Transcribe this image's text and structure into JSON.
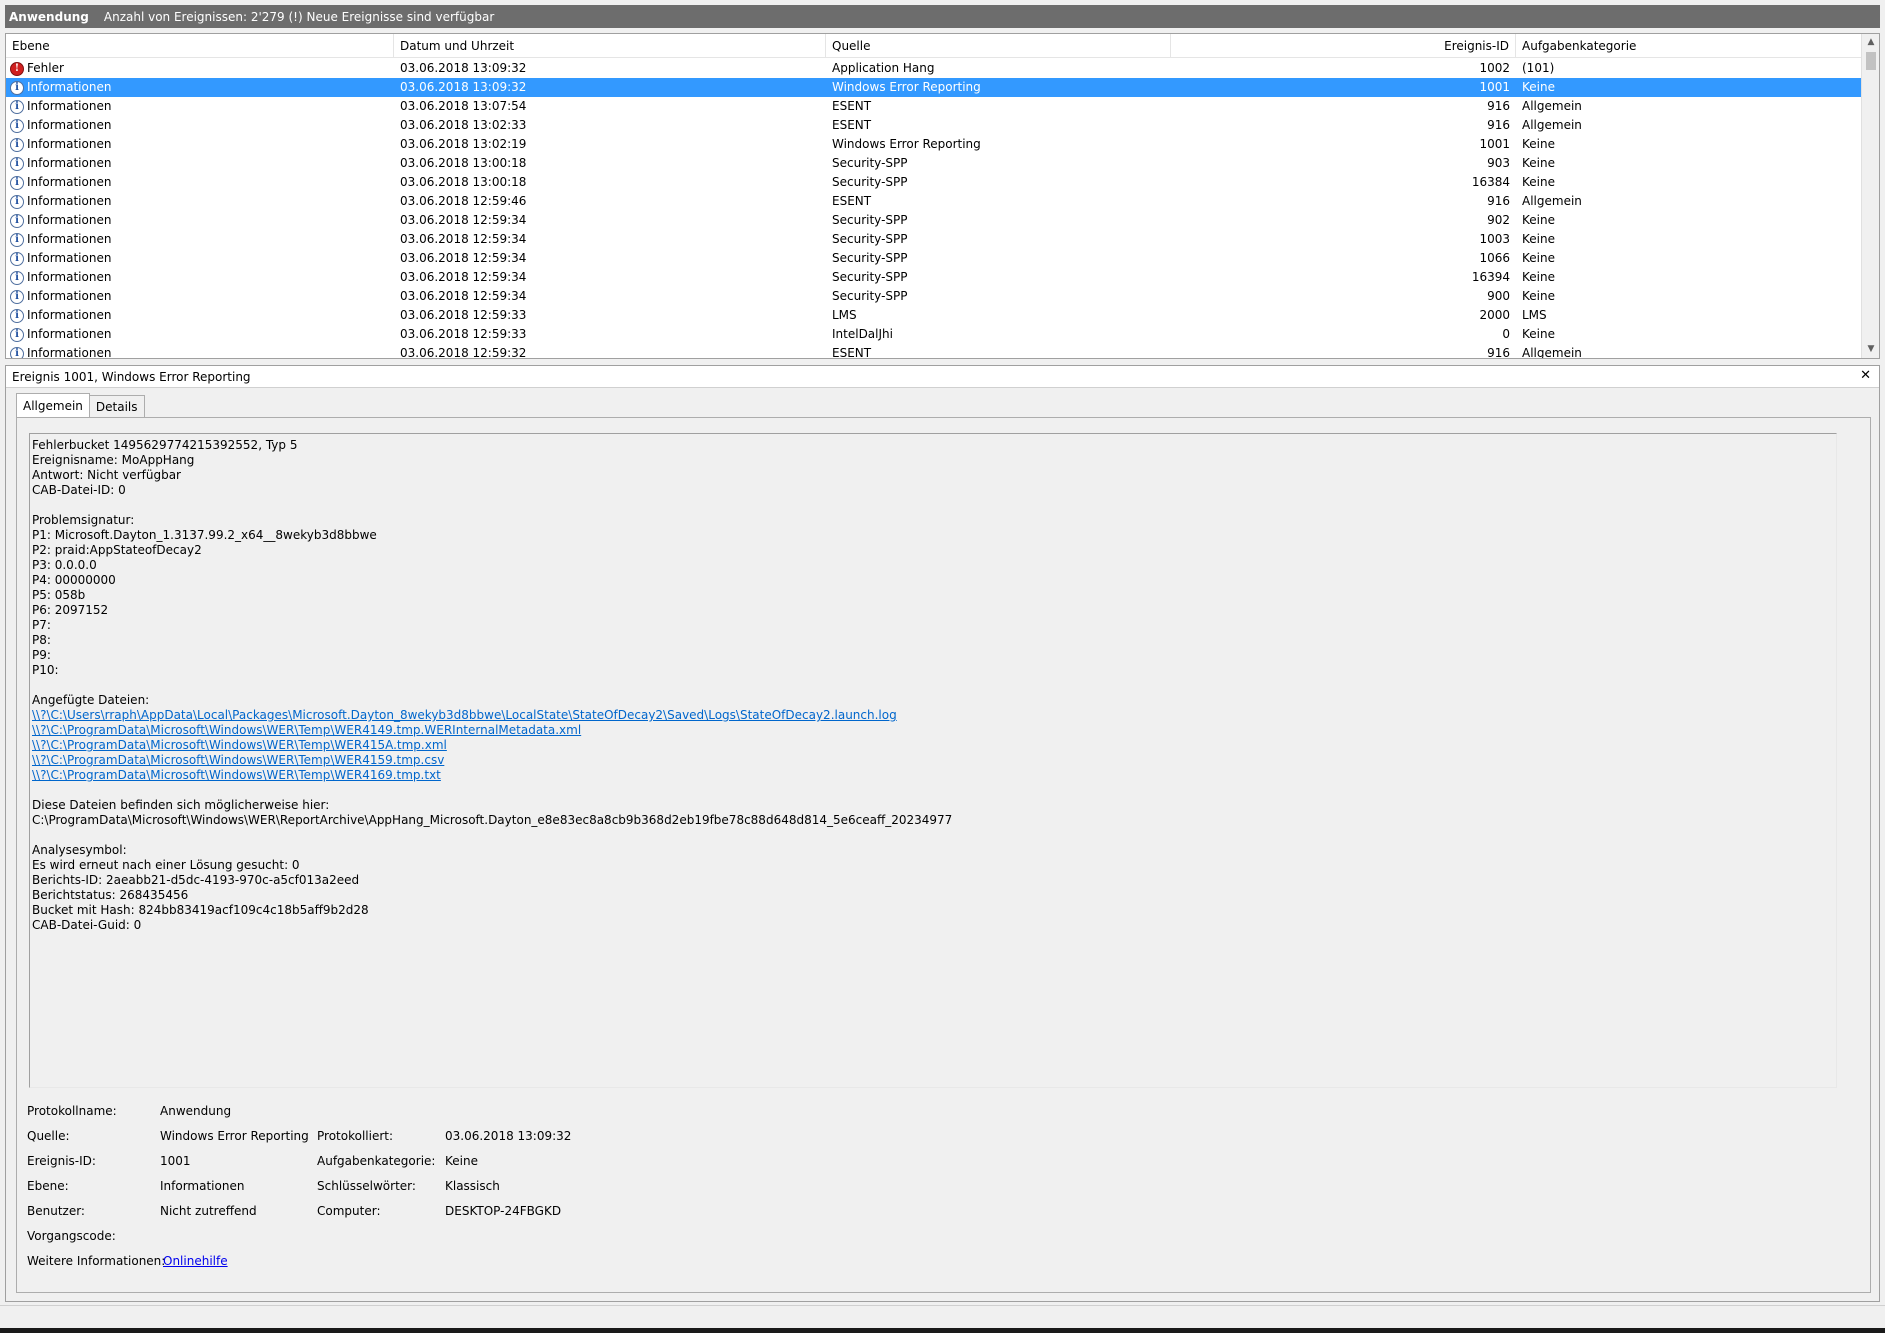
{
  "titlebar": {
    "app": "Anwendung",
    "info": "Anzahl von Ereignissen: 2'279 (!) Neue Ereignisse sind verfügbar"
  },
  "list": {
    "columns": [
      "Ebene",
      "Datum und Uhrzeit",
      "Quelle",
      "Ereignis-ID",
      "Aufgabenkategorie"
    ],
    "rows": [
      {
        "level": "Fehler",
        "icon": "error",
        "date": "03.06.2018 13:09:32",
        "source": "Application Hang",
        "id": "1002",
        "category": "(101)"
      },
      {
        "level": "Informationen",
        "icon": "info",
        "date": "03.06.2018 13:09:32",
        "source": "Windows Error Reporting",
        "id": "1001",
        "category": "Keine",
        "selected": true
      },
      {
        "level": "Informationen",
        "icon": "info",
        "date": "03.06.2018 13:07:54",
        "source": "ESENT",
        "id": "916",
        "category": "Allgemein"
      },
      {
        "level": "Informationen",
        "icon": "info",
        "date": "03.06.2018 13:02:33",
        "source": "ESENT",
        "id": "916",
        "category": "Allgemein"
      },
      {
        "level": "Informationen",
        "icon": "info",
        "date": "03.06.2018 13:02:19",
        "source": "Windows Error Reporting",
        "id": "1001",
        "category": "Keine"
      },
      {
        "level": "Informationen",
        "icon": "info",
        "date": "03.06.2018 13:00:18",
        "source": "Security-SPP",
        "id": "903",
        "category": "Keine"
      },
      {
        "level": "Informationen",
        "icon": "info",
        "date": "03.06.2018 13:00:18",
        "source": "Security-SPP",
        "id": "16384",
        "category": "Keine"
      },
      {
        "level": "Informationen",
        "icon": "info",
        "date": "03.06.2018 12:59:46",
        "source": "ESENT",
        "id": "916",
        "category": "Allgemein"
      },
      {
        "level": "Informationen",
        "icon": "info",
        "date": "03.06.2018 12:59:34",
        "source": "Security-SPP",
        "id": "902",
        "category": "Keine"
      },
      {
        "level": "Informationen",
        "icon": "info",
        "date": "03.06.2018 12:59:34",
        "source": "Security-SPP",
        "id": "1003",
        "category": "Keine"
      },
      {
        "level": "Informationen",
        "icon": "info",
        "date": "03.06.2018 12:59:34",
        "source": "Security-SPP",
        "id": "1066",
        "category": "Keine"
      },
      {
        "level": "Informationen",
        "icon": "info",
        "date": "03.06.2018 12:59:34",
        "source": "Security-SPP",
        "id": "16394",
        "category": "Keine"
      },
      {
        "level": "Informationen",
        "icon": "info",
        "date": "03.06.2018 12:59:34",
        "source": "Security-SPP",
        "id": "900",
        "category": "Keine"
      },
      {
        "level": "Informationen",
        "icon": "info",
        "date": "03.06.2018 12:59:33",
        "source": "LMS",
        "id": "2000",
        "category": "LMS"
      },
      {
        "level": "Informationen",
        "icon": "info",
        "date": "03.06.2018 12:59:33",
        "source": "IntelDalJhi",
        "id": "0",
        "category": "Keine"
      },
      {
        "level": "Informationen",
        "icon": "info",
        "date": "03.06.2018 12:59:32",
        "source": "ESENT",
        "id": "916",
        "category": "Allgemein"
      }
    ]
  },
  "detail": {
    "title": "Ereignis 1001, Windows Error Reporting",
    "close": "✕",
    "tabs": [
      "Allgemein",
      "Details"
    ],
    "text_lines": [
      {
        "text": "Fehlerbucket 1495629774215392552, Typ 5"
      },
      {
        "text": "Ereignisname: MoAppHang"
      },
      {
        "text": "Antwort: Nicht verfügbar"
      },
      {
        "text": "CAB-Datei-ID: 0"
      },
      {
        "text": ""
      },
      {
        "text": "Problemsignatur:"
      },
      {
        "text": "P1: Microsoft.Dayton_1.3137.99.2_x64__8wekyb3d8bbwe"
      },
      {
        "text": "P2: praid:AppStateofDecay2"
      },
      {
        "text": "P3: 0.0.0.0"
      },
      {
        "text": "P4: 00000000"
      },
      {
        "text": "P5: 058b"
      },
      {
        "text": "P6: 2097152"
      },
      {
        "text": "P7:"
      },
      {
        "text": "P8:"
      },
      {
        "text": "P9:"
      },
      {
        "text": "P10:"
      },
      {
        "text": ""
      },
      {
        "text": "Angefügte Dateien:"
      },
      {
        "text": "\\\\?\\C:\\Users\\rraph\\AppData\\Local\\Packages\\Microsoft.Dayton_8wekyb3d8bbwe\\LocalState\\StateOfDecay2\\Saved\\Logs\\StateOfDecay2.launch.log",
        "link": true
      },
      {
        "text": "\\\\?\\C:\\ProgramData\\Microsoft\\Windows\\WER\\Temp\\WER4149.tmp.WERInternalMetadata.xml",
        "link": true
      },
      {
        "text": "\\\\?\\C:\\ProgramData\\Microsoft\\Windows\\WER\\Temp\\WER415A.tmp.xml",
        "link": true
      },
      {
        "text": "\\\\?\\C:\\ProgramData\\Microsoft\\Windows\\WER\\Temp\\WER4159.tmp.csv",
        "link": true
      },
      {
        "text": "\\\\?\\C:\\ProgramData\\Microsoft\\Windows\\WER\\Temp\\WER4169.tmp.txt",
        "link": true
      },
      {
        "text": ""
      },
      {
        "text": "Diese Dateien befinden sich möglicherweise hier:"
      },
      {
        "text": "C:\\ProgramData\\Microsoft\\Windows\\WER\\ReportArchive\\AppHang_Microsoft.Dayton_e8e83ec8a8cb9b368d2eb19fbe78c88d648d814_5e6ceaff_20234977"
      },
      {
        "text": ""
      },
      {
        "text": "Analysesymbol:"
      },
      {
        "text": "Es wird erneut nach einer Lösung gesucht: 0"
      },
      {
        "text": "Berichts-ID: 2aeabb21-d5dc-4193-970c-a5cf013a2eed"
      },
      {
        "text": "Berichtstatus: 268435456"
      },
      {
        "text": "Bucket mit Hash: 824bb83419acf109c4c18b5aff9b2d28"
      },
      {
        "text": "CAB-Datei-Guid: 0"
      }
    ],
    "props": {
      "protokollname_label": "Protokollname:",
      "protokollname": "Anwendung",
      "quelle_label": "Quelle:",
      "quelle": "Windows Error Reporting",
      "protokolliert_label": "Protokolliert:",
      "protokolliert": "03.06.2018 13:09:32",
      "ereignis_label": "Ereignis-ID:",
      "ereignis": "1001",
      "aufgabe_label": "Aufgabenkategorie:",
      "aufgabe": "Keine",
      "ebene_label": "Ebene:",
      "ebene": "Informationen",
      "schluessel_label": "Schlüsselwörter:",
      "schluessel": "Klassisch",
      "benutzer_label": "Benutzer:",
      "benutzer": "Nicht zutreffend",
      "computer_label": "Computer:",
      "computer": "DESKTOP-24FBGKD",
      "vorgang_label": "Vorgangscode:",
      "vorgang": "",
      "weitere_label": "Weitere Informationen:",
      "weitere_link": "Onlinehilfe"
    }
  },
  "colors": {
    "selection": "#3399ff",
    "link": "#0066cc",
    "titlebar": "#6d6d6d"
  }
}
